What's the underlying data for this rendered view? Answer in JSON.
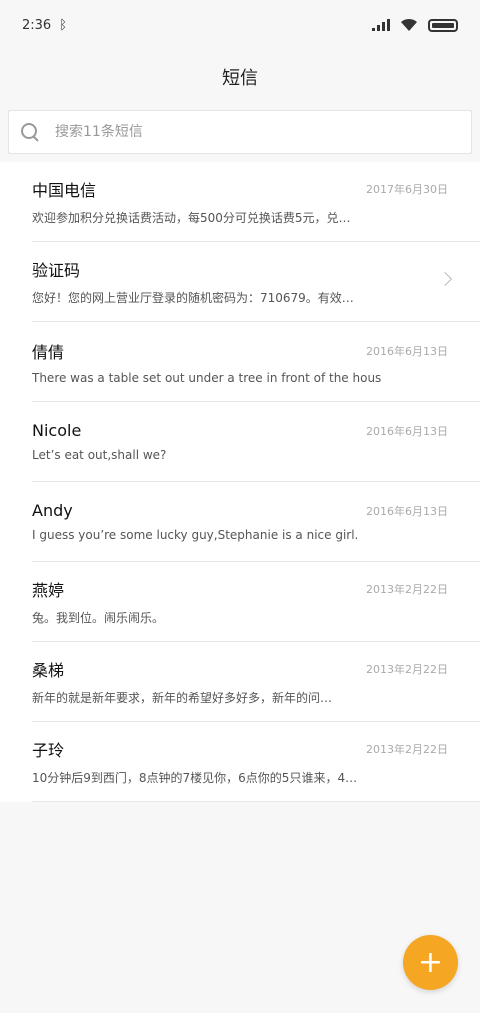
{
  "status": {
    "time": "2:36"
  },
  "header": {
    "title": "短信"
  },
  "search": {
    "placeholder": "搜索11条短信"
  },
  "messages": [
    {
      "name": "中国电信",
      "date": "2017年6月30日",
      "preview": "欢迎参加积分兑换话费活动，每500分可兑换话费5元，兑…"
    },
    {
      "name": "验证码",
      "date": "",
      "preview": "您好！您的网上营业厅登录的随机密码为：710679。有效…"
    },
    {
      "name": "倩倩",
      "date": "2016年6月13日",
      "preview": "There was a table set out under a tree in front of the hous"
    },
    {
      "name": "Nicole",
      "date": "2016年6月13日",
      "preview": "Let’s eat out,shall we?"
    },
    {
      "name": "Andy",
      "date": "2016年6月13日",
      "preview": "I guess you’re some lucky guy,Stephanie is a nice girl."
    },
    {
      "name": "燕婷",
      "date": "2013年2月22日",
      "preview": "兔。我到位。闹乐闹乐。"
    },
    {
      "name": "桑梯",
      "date": "2013年2月22日",
      "preview": "新年的就是新年要求，新年的希望好多好多，新年的问…"
    },
    {
      "name": "子玲",
      "date": "2013年2月22日",
      "preview": "10分钟后9到西门，8点钟的7楼见你，6点你的5只谁来，4…"
    }
  ],
  "fab": {
    "label": "+"
  },
  "colors": {
    "accent": "#f5a623"
  }
}
